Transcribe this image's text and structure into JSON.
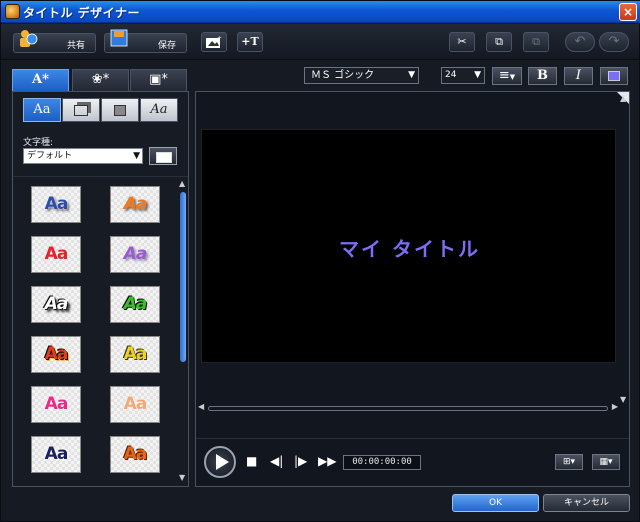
{
  "window": {
    "title": "タイトル デザイナー",
    "close_label": "×"
  },
  "toolbar": {
    "share_label": "共有",
    "save_label": "保存",
    "undo_glyph": "↶",
    "redo_glyph": "↷",
    "cut_glyph": "✂",
    "copy_glyph": "⧉",
    "paste_glyph": "⧉"
  },
  "tabs": [
    {
      "label": "A*",
      "icon": "text-style-icon"
    },
    {
      "label": "❀*",
      "icon": "particle-effect-icon"
    },
    {
      "label": "▣*",
      "icon": "background-icon"
    }
  ],
  "text_styles": [
    "Aa",
    "",
    "",
    "Aa"
  ],
  "charset": {
    "label": "文字種:",
    "selected": "デフォルト"
  },
  "presets": [
    {
      "text": "Aa",
      "color": "#2b4ea8"
    },
    {
      "text": "Aa",
      "color": "#f07a20"
    },
    {
      "text": "Aa",
      "color": "#e0262a"
    },
    {
      "text": "Aa",
      "color": "#9a5ad6"
    },
    {
      "text": "Aa",
      "color": "#ffffff"
    },
    {
      "text": "Aa",
      "color": "#3bbf2a"
    },
    {
      "text": "Aa",
      "color": "#e83a1a"
    },
    {
      "text": "Aa",
      "color": "#f2d21a"
    },
    {
      "text": "Aa",
      "color": "#ea2a86"
    },
    {
      "text": "Aa",
      "color": "#f4a878"
    },
    {
      "text": "Aa",
      "color": "#1a2060"
    },
    {
      "text": "Aa",
      "color": "#e06818"
    }
  ],
  "font_toolbar": {
    "font": "ＭＳ ゴシック",
    "size": "24",
    "align_glyph": "≡",
    "bold_label": "B",
    "italic_label": "I"
  },
  "preview": {
    "title_text": "マイ タイトル",
    "timecode": "00:00:00:00"
  },
  "buttons": {
    "ok": "OK",
    "cancel": "キャンセル"
  },
  "colors": {
    "accent": "#1d5fc4",
    "title_color": "#7b6ef5"
  }
}
